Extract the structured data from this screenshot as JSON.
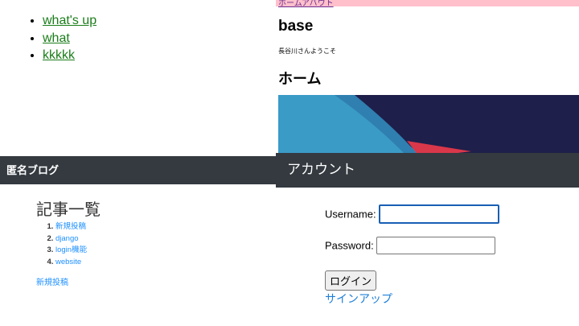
{
  "top_left": {
    "links": [
      "what's up",
      "what",
      "kkkkk"
    ]
  },
  "top_right": {
    "nav": {
      "home": "ホーム",
      "about": "アバウト"
    },
    "title": "base",
    "welcome": "長谷川さんようこそ",
    "heading": "ホーム"
  },
  "blog": {
    "header": "匿名ブログ",
    "title": "記事一覧",
    "posts": [
      "新規投稿",
      "django",
      "login機能",
      "website"
    ],
    "new_post": "新規投稿"
  },
  "login": {
    "header": "アカウント",
    "username_label": "Username:",
    "password_label": "Password:",
    "username_value": "",
    "password_value": "",
    "submit": "ログイン",
    "signup": "サインアップ"
  },
  "colors": {
    "navbar": "#343a40",
    "link_green": "#1a7d1a",
    "link_blue": "#1e90ff",
    "pink_bar": "#ffc0cb"
  }
}
